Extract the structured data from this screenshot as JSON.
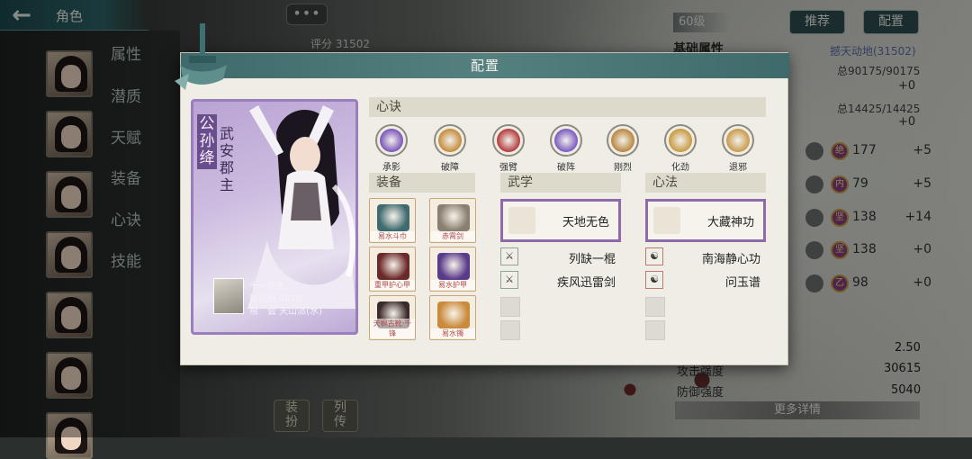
{
  "topbar": {
    "back_icon": "back-arrow-icon",
    "title": "角色",
    "more": "•••"
  },
  "bg_score": "评分 31502",
  "nav": [
    "属性",
    "潜质",
    "天赋",
    "装备",
    "心诀",
    "技能"
  ],
  "right_panel": {
    "recommend": "推荐",
    "config": "配置",
    "level": "60级",
    "attr_title": "基础属性",
    "power": "撼天动地(31502)",
    "hp": "总90175/90175",
    "hp_plus": "+0",
    "mp": "总14425/14425",
    "mp_plus": "+0",
    "stats": [
      {
        "gem": "绝",
        "value": "177",
        "add": "+5"
      },
      {
        "gem": "内",
        "value": "79",
        "add": "+5"
      },
      {
        "gem": "坚",
        "value": "138",
        "add": "+14"
      },
      {
        "gem": "坚",
        "value": "138",
        "add": "+0"
      },
      {
        "gem": "乙",
        "value": "98",
        "add": "+0"
      }
    ],
    "extra_value": "2.50",
    "attack_label": "攻击强度",
    "attack_value": "30615",
    "defense_label": "防御强度",
    "defense_value": "5040",
    "more_details": "更多详情"
  },
  "bottom": {
    "b1": "装\n扮",
    "b2": "列\n传"
  },
  "modal": {
    "title": "配置",
    "card": {
      "surname": "公孙绛",
      "title": "武安郡主",
      "line1": "十一先生、",
      "line2": "论剑分 4010",
      "line3": "帮　会 天山派(水)"
    },
    "xinjue_label": "心诀",
    "xinjue": [
      {
        "name": "承影",
        "color": "#7a55b8"
      },
      {
        "name": "破障",
        "color": "#c58a3a"
      },
      {
        "name": "强臂",
        "color": "#b23b3b"
      },
      {
        "name": "破阵",
        "color": "#7b5ac0"
      },
      {
        "name": "刚烈",
        "color": "#b9863e"
      },
      {
        "name": "化劲",
        "color": "#c8993f"
      },
      {
        "name": "退邪",
        "color": "#c99a4a"
      }
    ],
    "equip_label": "装备",
    "equip": [
      {
        "name": "易水斗巾",
        "color": "#3f6a6e"
      },
      {
        "name": "赤霄剑",
        "color": "#8a7f70"
      },
      {
        "name": "重甲护心甲",
        "color": "#6b2a2a"
      },
      {
        "name": "易水护甲",
        "color": "#5a3a8a"
      },
      {
        "name": "天枫古靴·千锋",
        "color": "#3a2a2a"
      },
      {
        "name": "易水镯",
        "color": "#c98a3a"
      }
    ],
    "wuxue_label": "武学",
    "wuxue_main": "天地无色",
    "wuxue_subs": [
      "列缺一棍",
      "疾风迅雷剑"
    ],
    "xinfa_label": "心法",
    "xinfa_main": "大藏神功",
    "xinfa_subs": [
      "南海静心功",
      "问玉谱"
    ]
  }
}
